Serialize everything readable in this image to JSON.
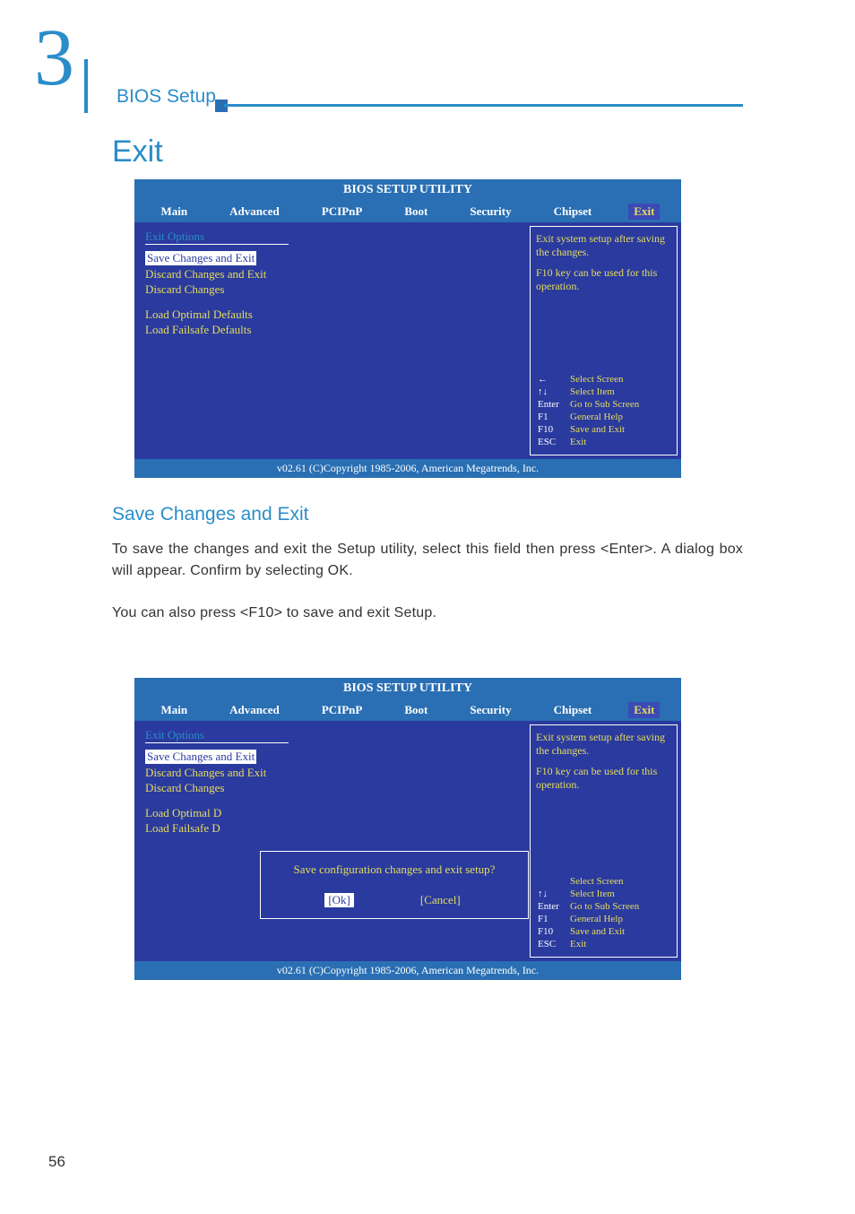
{
  "header": {
    "chapter_num": "3",
    "bios_setup_label": "BIOS Setup"
  },
  "page": {
    "title": "Exit",
    "page_num": "56"
  },
  "bios": {
    "title": "BIOS SETUP UTILITY",
    "tabs": {
      "main": "Main",
      "advanced": "Advanced",
      "pcipnp": "PCIPnP",
      "boot": "Boot",
      "security": "Security",
      "chipset": "Chipset",
      "exit": " Exit "
    },
    "exit_options_label": "Exit Options",
    "menu": {
      "save_exit": "Save Changes and Exit",
      "discard_exit": "Discard Changes and Exit",
      "discard": "Discard Changes",
      "load_optimal": "Load Optimal Defaults",
      "load_failsafe": "Load Failsafe Defaults",
      "load_optimal_short": "Load Optimal D",
      "load_failsafe_short": "Load Failsafe D"
    },
    "help": {
      "line1": "Exit system setup after saving the changes.",
      "line2": "F10 key can be used for this operation."
    },
    "keys": {
      "arrow_l": "←",
      "arrow_ud": "↑↓",
      "enter": "Enter",
      "f1": "F1",
      "f10": "F10",
      "esc": "ESC",
      "select_screen": "Select Screen",
      "select_item": "Select Item",
      "go_sub": "Go to Sub Screen",
      "general_help": "General Help",
      "save_exit": "Save and Exit",
      "exit": "Exit"
    },
    "footer": "v02.61 (C)Copyright 1985-2006, American Megatrends, Inc."
  },
  "section": {
    "title": "Save Changes and Exit",
    "para1": "To save the changes and exit the Setup utility, select this field then press <Enter>. A dialog box will appear. Confirm by selecting OK.",
    "para2": "You can also press <F10> to save and exit Setup."
  },
  "dialog": {
    "message": "Save configuration changes and exit setup?",
    "ok": "[Ok]",
    "cancel": "[Cancel]"
  }
}
